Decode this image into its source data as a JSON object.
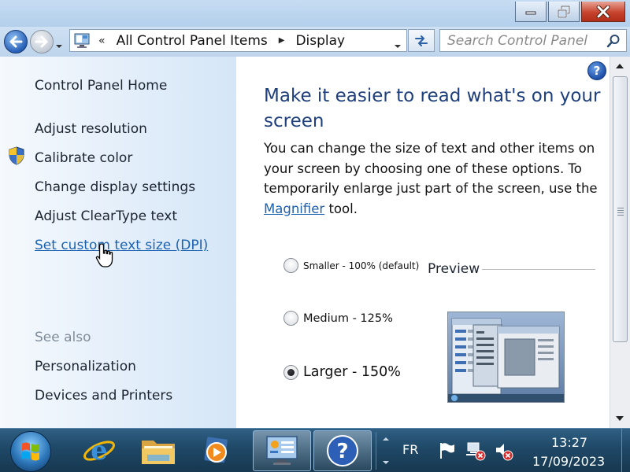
{
  "window": {
    "minimize_icon": "minimize-icon",
    "maximize_icon": "restore-icon",
    "close_icon": "close-icon"
  },
  "nav": {
    "back_icon": "back-arrow-icon",
    "forward_icon": "forward-arrow-icon",
    "history_dropdown_icon": "chevron-down-icon"
  },
  "address": {
    "overflow_chevron": "«",
    "crumbs": [
      "All Control Panel Items",
      "Display"
    ],
    "separator_glyph": "▶"
  },
  "search": {
    "placeholder": "Search Control Panel"
  },
  "sidebar": {
    "home": "Control Panel Home",
    "tasks": [
      "Adjust resolution",
      "Calibrate color",
      "Change display settings",
      "Adjust ClearType text",
      "Set custom text size (DPI)"
    ],
    "see_also_label": "See also",
    "see_also": [
      "Personalization",
      "Devices and Printers"
    ]
  },
  "main": {
    "help_glyph": "?",
    "heading": "Make it easier to read what's on your screen",
    "description_before": "You can change the size of text and other items on your screen by choosing one of these options. To temporarily enlarge just part of the screen, use the ",
    "magnifier_link": "Magnifier",
    "description_after": " tool.",
    "options": [
      {
        "label": "Smaller - 100% (default)",
        "checked": false
      },
      {
        "label": "Medium - 125%",
        "checked": false
      },
      {
        "label": "Larger - 150%",
        "checked": true
      }
    ],
    "preview_label": "Preview"
  },
  "taskbar": {
    "apps": [
      "start-orb-icon",
      "internet-explorer-icon",
      "file-explorer-icon",
      "media-player-icon",
      "control-panel-icon",
      "help-and-support-icon"
    ],
    "language": "FR",
    "time": "13:27",
    "date": "17/09/2023"
  },
  "colors": {
    "heading": "#1e3f7b",
    "link": "#1c62b0",
    "muted": "#7f8c9a",
    "close_button": "#c7442e",
    "taskbar": "#1f4867"
  }
}
